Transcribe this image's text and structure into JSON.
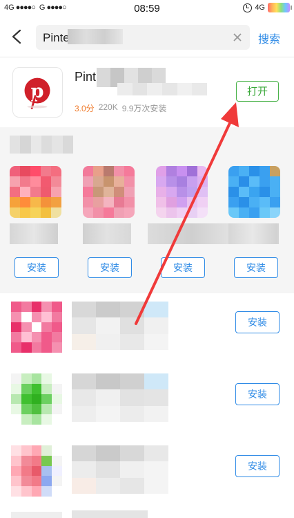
{
  "status_bar": {
    "left_carrier_1": "4G",
    "left_dots_1": "●●●●○",
    "left_carrier_2": "G",
    "left_dots_2": "●●●●○",
    "time": "08:59",
    "network": "4G"
  },
  "search": {
    "query": "Pinte",
    "submit_label": "搜索"
  },
  "main_app": {
    "name": "Pint",
    "rating": "3.0分",
    "size": "220K",
    "installs": "9.9万次安装",
    "open_label": "打开"
  },
  "recommend": {
    "install_label": "安装",
    "install_labels": [
      "安装",
      "安装",
      "安装",
      "安装"
    ]
  },
  "list": {
    "install_labels": [
      "安装",
      "安装",
      "安装"
    ]
  },
  "colors": {
    "accent_blue": "#2f8be6",
    "open_green": "#3aa83a",
    "rating_orange": "#f07a2a",
    "arrow_red": "#f03a3a"
  },
  "icons": [
    "back-icon",
    "clear-icon",
    "alarm-icon",
    "battery-icon",
    "pinterest-logo-icon"
  ]
}
